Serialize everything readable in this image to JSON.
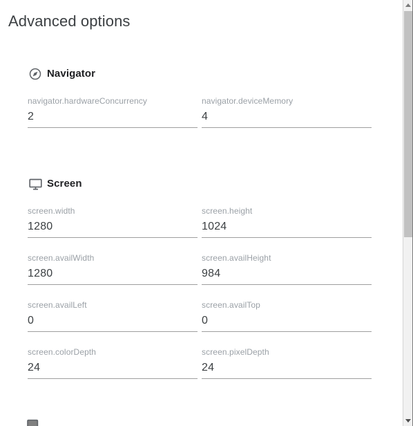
{
  "page": {
    "title": "Advanced options"
  },
  "sections": [
    {
      "id": "navigator",
      "title": "Navigator",
      "icon": "compass-icon",
      "rows": [
        [
          {
            "label": "navigator.hardwareConcurrency",
            "value": "2"
          },
          {
            "label": "navigator.deviceMemory",
            "value": "4"
          }
        ]
      ]
    },
    {
      "id": "screen",
      "title": "Screen",
      "icon": "desktop-monitor-icon",
      "rows": [
        [
          {
            "label": "screen.width",
            "value": "1280"
          },
          {
            "label": "screen.height",
            "value": "1024"
          }
        ],
        [
          {
            "label": "screen.availWidth",
            "value": "1280"
          },
          {
            "label": "screen.availHeight",
            "value": "984"
          }
        ],
        [
          {
            "label": "screen.availLeft",
            "value": "0"
          },
          {
            "label": "screen.availTop",
            "value": "0"
          }
        ],
        [
          {
            "label": "screen.colorDepth",
            "value": "24"
          },
          {
            "label": "screen.pixelDepth",
            "value": "24"
          }
        ]
      ]
    }
  ],
  "colors": {
    "label": "#9aa0a6",
    "value": "#3c4043",
    "underline": "#9e9e9e",
    "title": "#3c4043",
    "scrollbar_thumb": "#c1c1c1",
    "scrollbar_track": "#f1f1f1"
  },
  "scrollbar": {
    "up_arrow": "scroll-up-arrow",
    "down_arrow": "scroll-down-arrow",
    "thumb": "scroll-thumb"
  }
}
